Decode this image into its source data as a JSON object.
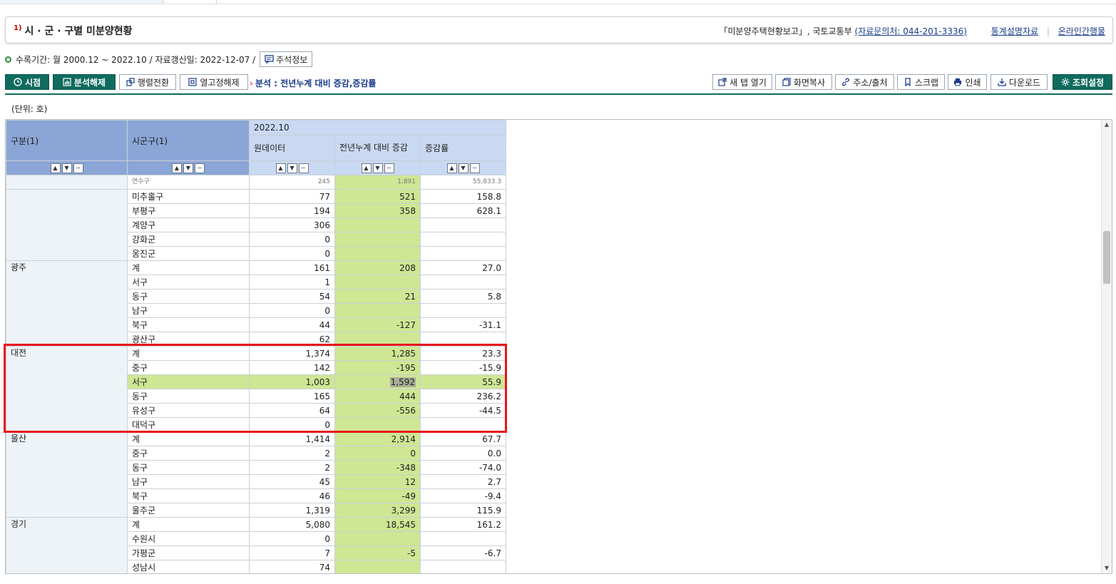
{
  "page": {
    "title_sup": "1)",
    "title": "시 · 군 · 구별 미분양현황",
    "source_text": "「미분양주택현황보고」, 국토교통부",
    "source_contact": "(자료문의처: 044-201-3336)",
    "link_stat_desc": "통계설명자료",
    "link_online": "온라인간행물",
    "period_text": "수록기간: 월 2000.12 ~ 2022.10 / 자료갱신일: 2022-12-07 /",
    "note_button": "주석정보",
    "unit_text": "(단위: 호)"
  },
  "toolbar": {
    "time_label": "시점",
    "analysis_off_label": "분석해제",
    "pivot_label": "행렬전환",
    "unfreeze_label": "열고정해제",
    "analysis_text": "분석 : 전년누계 대비 증감,증감률",
    "new_tab_label": "새 탭 열기",
    "screen_copy_label": "화면복사",
    "address_label": "주소/출처",
    "scrap_label": "스크랩",
    "print_label": "인쇄",
    "download_label": "다운로드",
    "settings_label": "조회설정"
  },
  "table": {
    "col_group": "구분(1)",
    "col_district": "시군구(1)",
    "period": "2022.10",
    "col_raw": "원데이터",
    "col_diff": "전년누계 대비 증감",
    "col_rate": "증감률",
    "partial_row": {
      "district": "연수구",
      "raw": "245",
      "diff": "1,891",
      "rate": "55,833.3"
    },
    "rows": [
      {
        "group": "",
        "district": "미추홀구",
        "raw": "77",
        "diff": "521",
        "rate": "158.8"
      },
      {
        "group": "",
        "district": "부평구",
        "raw": "194",
        "diff": "358",
        "rate": "628.1"
      },
      {
        "group": "",
        "district": "계양구",
        "raw": "306",
        "diff": "",
        "rate": ""
      },
      {
        "group": "",
        "district": "강화군",
        "raw": "0",
        "diff": "",
        "rate": ""
      },
      {
        "group": "",
        "district": "옹진군",
        "raw": "0",
        "diff": "",
        "rate": ""
      },
      {
        "group": "광주",
        "district": "계",
        "raw": "161",
        "diff": "208",
        "rate": "27.0"
      },
      {
        "group": "",
        "district": "서구",
        "raw": "1",
        "diff": "",
        "rate": ""
      },
      {
        "group": "",
        "district": "동구",
        "raw": "54",
        "diff": "21",
        "rate": "5.8"
      },
      {
        "group": "",
        "district": "남구",
        "raw": "0",
        "diff": "",
        "rate": ""
      },
      {
        "group": "",
        "district": "북구",
        "raw": "44",
        "diff": "-127",
        "rate": "-31.1"
      },
      {
        "group": "",
        "district": "광산구",
        "raw": "62",
        "diff": "",
        "rate": ""
      },
      {
        "group": "대전",
        "district": "계",
        "raw": "1,374",
        "diff": "1,285",
        "rate": "23.3"
      },
      {
        "group": "",
        "district": "중구",
        "raw": "142",
        "diff": "-195",
        "rate": "-15.9"
      },
      {
        "group": "",
        "district": "서구",
        "raw": "1,003",
        "diff": "1,592",
        "rate": "55.9",
        "highlight": true
      },
      {
        "group": "",
        "district": "동구",
        "raw": "165",
        "diff": "444",
        "rate": "236.2"
      },
      {
        "group": "",
        "district": "유성구",
        "raw": "64",
        "diff": "-556",
        "rate": "-44.5"
      },
      {
        "group": "",
        "district": "대덕구",
        "raw": "0",
        "diff": "",
        "rate": ""
      },
      {
        "group": "울산",
        "district": "계",
        "raw": "1,414",
        "diff": "2,914",
        "rate": "67.7"
      },
      {
        "group": "",
        "district": "중구",
        "raw": "2",
        "diff": "0",
        "rate": "0.0"
      },
      {
        "group": "",
        "district": "동구",
        "raw": "2",
        "diff": "-348",
        "rate": "-74.0"
      },
      {
        "group": "",
        "district": "남구",
        "raw": "45",
        "diff": "12",
        "rate": "2.7"
      },
      {
        "group": "",
        "district": "북구",
        "raw": "46",
        "diff": "-49",
        "rate": "-9.4"
      },
      {
        "group": "",
        "district": "울주군",
        "raw": "1,319",
        "diff": "3,299",
        "rate": "115.9"
      },
      {
        "group": "경기",
        "district": "계",
        "raw": "5,080",
        "diff": "18,545",
        "rate": "161.2"
      },
      {
        "group": "",
        "district": "수원시",
        "raw": "0",
        "diff": "",
        "rate": ""
      },
      {
        "group": "",
        "district": "가평군",
        "raw": "7",
        "diff": "-5",
        "rate": "-6.7"
      },
      {
        "group": "",
        "district": "성남시",
        "raw": "74",
        "diff": "",
        "rate": ""
      }
    ]
  }
}
